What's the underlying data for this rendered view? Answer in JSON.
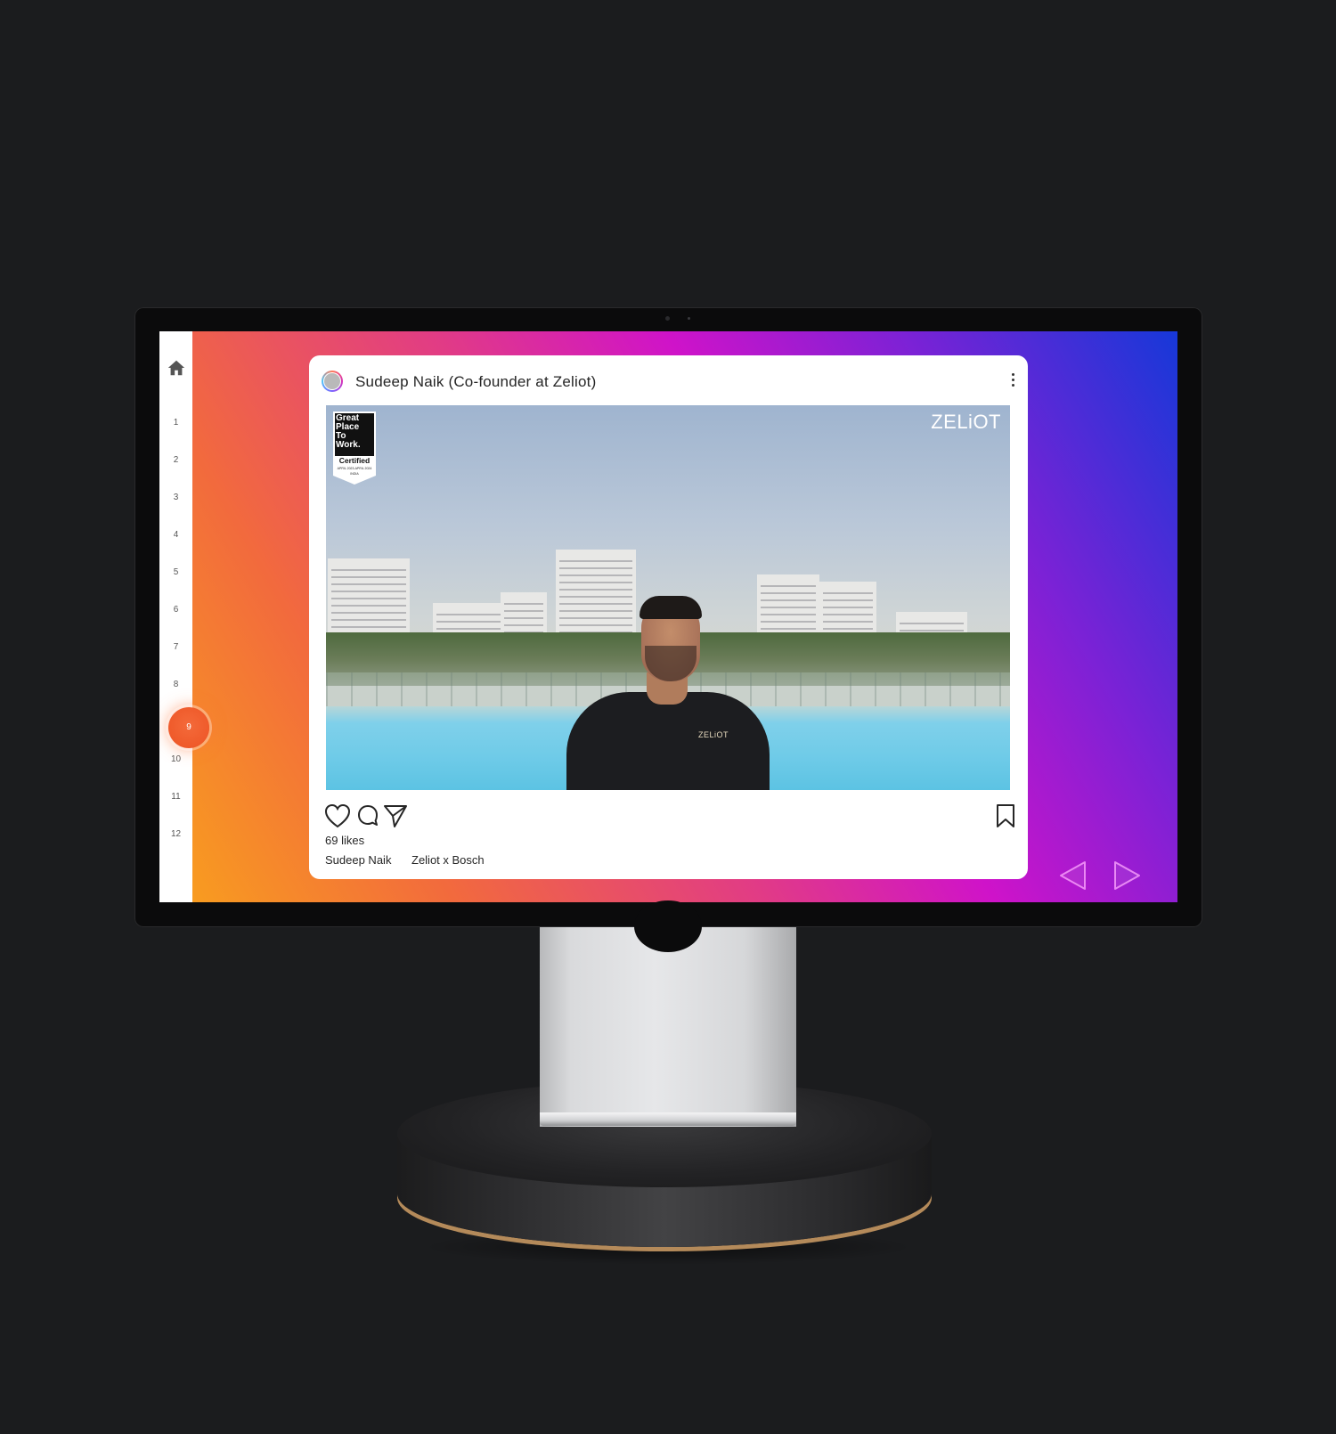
{
  "sidebar": {
    "home_icon": "home-icon",
    "items": [
      "1",
      "2",
      "3",
      "4",
      "5",
      "6",
      "7",
      "8",
      "9",
      "10",
      "11",
      "12"
    ],
    "active_item": "9"
  },
  "post": {
    "author": "Sudeep Naik (Co-founder at Zeliot)",
    "media": {
      "badge_lines": [
        "Great",
        "Place",
        "To",
        "Work."
      ],
      "badge_certified": "Certified",
      "badge_dates": "APRIL 2023-APRIL 2024",
      "badge_country": "INDIA",
      "brand_watermark": "ZELiOT",
      "shirt_logo": "ZELiOT"
    },
    "likes": "69 likes",
    "caption_user": "Sudeep Naik",
    "caption_text": "Zeliot x Bosch"
  },
  "navigation": {
    "prev_icon": "triangle-left-icon",
    "next_icon": "triangle-right-icon"
  },
  "colors": {
    "gradient_start": "#f9a21c",
    "gradient_mid": "#cf13c9",
    "gradient_end": "#1638d8",
    "active_nav": "#ef5a2a"
  }
}
